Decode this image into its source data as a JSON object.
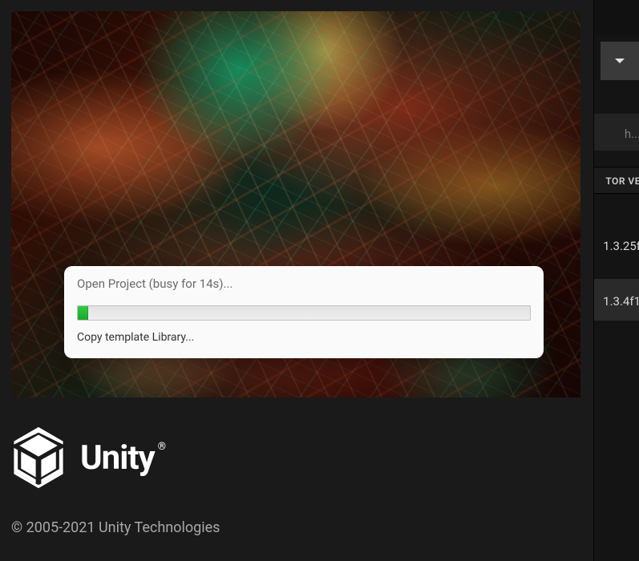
{
  "dialog": {
    "title": "Open Project (busy for 14s)...",
    "status": "Copy template Library...",
    "progress_percent": 2.3
  },
  "branding": {
    "name": "Unity",
    "registered_mark": "®",
    "copyright": "© 2005-2021 Unity Technologies"
  },
  "sidebar": {
    "search_placeholder_fragment": "h...",
    "column_header_fragment": "TOR VE",
    "versions": [
      "1.3.25f",
      "1.3.4f1"
    ]
  }
}
